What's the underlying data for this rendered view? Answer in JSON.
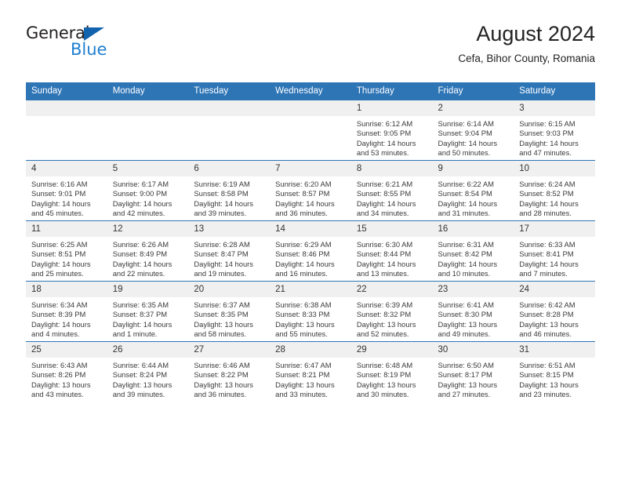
{
  "brand": {
    "name_part1": "General",
    "name_part2": "Blue",
    "accent_color": "#1f7fd0",
    "triangle_color": "#1263ad"
  },
  "header": {
    "title": "August 2024",
    "subtitle": "Cefa, Bihor County, Romania",
    "header_bg_color": "#2e75b6",
    "daynum_bg_color": "#f0f0f0"
  },
  "weekday_headers": [
    "Sunday",
    "Monday",
    "Tuesday",
    "Wednesday",
    "Thursday",
    "Friday",
    "Saturday"
  ],
  "weeks": [
    [
      {
        "day": "",
        "sunrise": "",
        "sunset": "",
        "daylight1": "",
        "daylight2": "",
        "empty": true
      },
      {
        "day": "",
        "sunrise": "",
        "sunset": "",
        "daylight1": "",
        "daylight2": "",
        "empty": true
      },
      {
        "day": "",
        "sunrise": "",
        "sunset": "",
        "daylight1": "",
        "daylight2": "",
        "empty": true
      },
      {
        "day": "",
        "sunrise": "",
        "sunset": "",
        "daylight1": "",
        "daylight2": "",
        "empty": true
      },
      {
        "day": "1",
        "sunrise": "Sunrise: 6:12 AM",
        "sunset": "Sunset: 9:05 PM",
        "daylight1": "Daylight: 14 hours",
        "daylight2": "and 53 minutes."
      },
      {
        "day": "2",
        "sunrise": "Sunrise: 6:14 AM",
        "sunset": "Sunset: 9:04 PM",
        "daylight1": "Daylight: 14 hours",
        "daylight2": "and 50 minutes."
      },
      {
        "day": "3",
        "sunrise": "Sunrise: 6:15 AM",
        "sunset": "Sunset: 9:03 PM",
        "daylight1": "Daylight: 14 hours",
        "daylight2": "and 47 minutes."
      }
    ],
    [
      {
        "day": "4",
        "sunrise": "Sunrise: 6:16 AM",
        "sunset": "Sunset: 9:01 PM",
        "daylight1": "Daylight: 14 hours",
        "daylight2": "and 45 minutes."
      },
      {
        "day": "5",
        "sunrise": "Sunrise: 6:17 AM",
        "sunset": "Sunset: 9:00 PM",
        "daylight1": "Daylight: 14 hours",
        "daylight2": "and 42 minutes."
      },
      {
        "day": "6",
        "sunrise": "Sunrise: 6:19 AM",
        "sunset": "Sunset: 8:58 PM",
        "daylight1": "Daylight: 14 hours",
        "daylight2": "and 39 minutes."
      },
      {
        "day": "7",
        "sunrise": "Sunrise: 6:20 AM",
        "sunset": "Sunset: 8:57 PM",
        "daylight1": "Daylight: 14 hours",
        "daylight2": "and 36 minutes."
      },
      {
        "day": "8",
        "sunrise": "Sunrise: 6:21 AM",
        "sunset": "Sunset: 8:55 PM",
        "daylight1": "Daylight: 14 hours",
        "daylight2": "and 34 minutes."
      },
      {
        "day": "9",
        "sunrise": "Sunrise: 6:22 AM",
        "sunset": "Sunset: 8:54 PM",
        "daylight1": "Daylight: 14 hours",
        "daylight2": "and 31 minutes."
      },
      {
        "day": "10",
        "sunrise": "Sunrise: 6:24 AM",
        "sunset": "Sunset: 8:52 PM",
        "daylight1": "Daylight: 14 hours",
        "daylight2": "and 28 minutes."
      }
    ],
    [
      {
        "day": "11",
        "sunrise": "Sunrise: 6:25 AM",
        "sunset": "Sunset: 8:51 PM",
        "daylight1": "Daylight: 14 hours",
        "daylight2": "and 25 minutes."
      },
      {
        "day": "12",
        "sunrise": "Sunrise: 6:26 AM",
        "sunset": "Sunset: 8:49 PM",
        "daylight1": "Daylight: 14 hours",
        "daylight2": "and 22 minutes."
      },
      {
        "day": "13",
        "sunrise": "Sunrise: 6:28 AM",
        "sunset": "Sunset: 8:47 PM",
        "daylight1": "Daylight: 14 hours",
        "daylight2": "and 19 minutes."
      },
      {
        "day": "14",
        "sunrise": "Sunrise: 6:29 AM",
        "sunset": "Sunset: 8:46 PM",
        "daylight1": "Daylight: 14 hours",
        "daylight2": "and 16 minutes."
      },
      {
        "day": "15",
        "sunrise": "Sunrise: 6:30 AM",
        "sunset": "Sunset: 8:44 PM",
        "daylight1": "Daylight: 14 hours",
        "daylight2": "and 13 minutes."
      },
      {
        "day": "16",
        "sunrise": "Sunrise: 6:31 AM",
        "sunset": "Sunset: 8:42 PM",
        "daylight1": "Daylight: 14 hours",
        "daylight2": "and 10 minutes."
      },
      {
        "day": "17",
        "sunrise": "Sunrise: 6:33 AM",
        "sunset": "Sunset: 8:41 PM",
        "daylight1": "Daylight: 14 hours",
        "daylight2": "and 7 minutes."
      }
    ],
    [
      {
        "day": "18",
        "sunrise": "Sunrise: 6:34 AM",
        "sunset": "Sunset: 8:39 PM",
        "daylight1": "Daylight: 14 hours",
        "daylight2": "and 4 minutes."
      },
      {
        "day": "19",
        "sunrise": "Sunrise: 6:35 AM",
        "sunset": "Sunset: 8:37 PM",
        "daylight1": "Daylight: 14 hours",
        "daylight2": "and 1 minute."
      },
      {
        "day": "20",
        "sunrise": "Sunrise: 6:37 AM",
        "sunset": "Sunset: 8:35 PM",
        "daylight1": "Daylight: 13 hours",
        "daylight2": "and 58 minutes."
      },
      {
        "day": "21",
        "sunrise": "Sunrise: 6:38 AM",
        "sunset": "Sunset: 8:33 PM",
        "daylight1": "Daylight: 13 hours",
        "daylight2": "and 55 minutes."
      },
      {
        "day": "22",
        "sunrise": "Sunrise: 6:39 AM",
        "sunset": "Sunset: 8:32 PM",
        "daylight1": "Daylight: 13 hours",
        "daylight2": "and 52 minutes."
      },
      {
        "day": "23",
        "sunrise": "Sunrise: 6:41 AM",
        "sunset": "Sunset: 8:30 PM",
        "daylight1": "Daylight: 13 hours",
        "daylight2": "and 49 minutes."
      },
      {
        "day": "24",
        "sunrise": "Sunrise: 6:42 AM",
        "sunset": "Sunset: 8:28 PM",
        "daylight1": "Daylight: 13 hours",
        "daylight2": "and 46 minutes."
      }
    ],
    [
      {
        "day": "25",
        "sunrise": "Sunrise: 6:43 AM",
        "sunset": "Sunset: 8:26 PM",
        "daylight1": "Daylight: 13 hours",
        "daylight2": "and 43 minutes."
      },
      {
        "day": "26",
        "sunrise": "Sunrise: 6:44 AM",
        "sunset": "Sunset: 8:24 PM",
        "daylight1": "Daylight: 13 hours",
        "daylight2": "and 39 minutes."
      },
      {
        "day": "27",
        "sunrise": "Sunrise: 6:46 AM",
        "sunset": "Sunset: 8:22 PM",
        "daylight1": "Daylight: 13 hours",
        "daylight2": "and 36 minutes."
      },
      {
        "day": "28",
        "sunrise": "Sunrise: 6:47 AM",
        "sunset": "Sunset: 8:21 PM",
        "daylight1": "Daylight: 13 hours",
        "daylight2": "and 33 minutes."
      },
      {
        "day": "29",
        "sunrise": "Sunrise: 6:48 AM",
        "sunset": "Sunset: 8:19 PM",
        "daylight1": "Daylight: 13 hours",
        "daylight2": "and 30 minutes."
      },
      {
        "day": "30",
        "sunrise": "Sunrise: 6:50 AM",
        "sunset": "Sunset: 8:17 PM",
        "daylight1": "Daylight: 13 hours",
        "daylight2": "and 27 minutes."
      },
      {
        "day": "31",
        "sunrise": "Sunrise: 6:51 AM",
        "sunset": "Sunset: 8:15 PM",
        "daylight1": "Daylight: 13 hours",
        "daylight2": "and 23 minutes."
      }
    ]
  ]
}
